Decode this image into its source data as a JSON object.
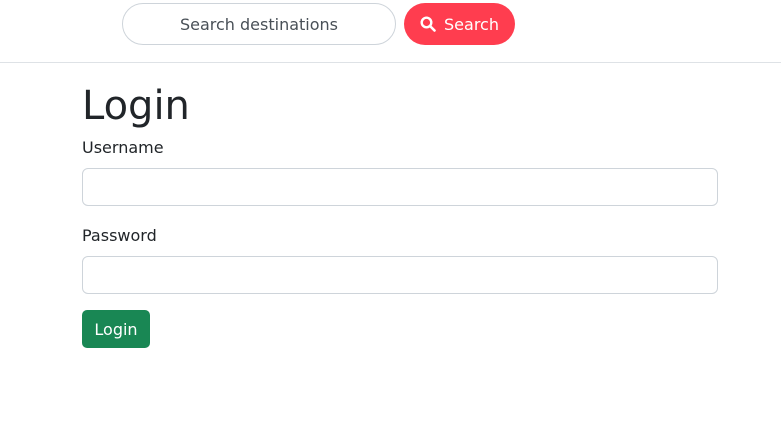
{
  "header": {
    "search": {
      "placeholder": "Search destinations",
      "value": ""
    },
    "search_button": {
      "label": "Search",
      "icon": "search-icon",
      "color": "#ff3d4f"
    }
  },
  "login_form": {
    "title": "Login",
    "username": {
      "label": "Username",
      "value": ""
    },
    "password": {
      "label": "Password",
      "value": ""
    },
    "submit": {
      "label": "Login",
      "color": "#198754"
    }
  }
}
